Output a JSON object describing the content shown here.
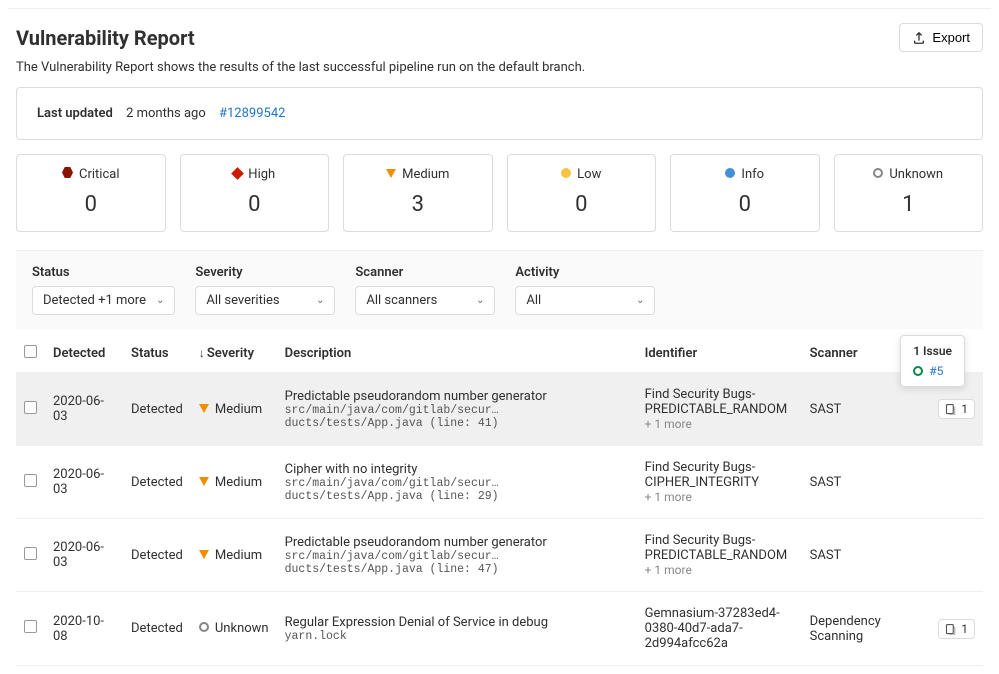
{
  "header": {
    "title": "Vulnerability Report",
    "export_label": "Export",
    "subtitle": "The Vulnerability Report shows the results of the last successful pipeline run on the default branch."
  },
  "last_updated": {
    "label": "Last updated",
    "ago": "2 months ago",
    "pipeline_link": "#12899542"
  },
  "severity_cards": [
    {
      "name": "Critical",
      "count": "0",
      "color": "#8b1300",
      "shape": "hexagon"
    },
    {
      "name": "High",
      "count": "0",
      "color": "#c91c00",
      "shape": "diamond"
    },
    {
      "name": "Medium",
      "count": "3",
      "color": "#ef8e00",
      "shape": "triangle-down"
    },
    {
      "name": "Low",
      "count": "0",
      "color": "#f6c342",
      "shape": "circle-fill"
    },
    {
      "name": "Info",
      "count": "0",
      "color": "#428fdc",
      "shape": "circle-fill"
    },
    {
      "name": "Unknown",
      "count": "1",
      "color": "#868686",
      "shape": "ring"
    }
  ],
  "filters": {
    "status": {
      "label": "Status",
      "value": "Detected +1 more"
    },
    "severity": {
      "label": "Severity",
      "value": "All severities"
    },
    "scanner": {
      "label": "Scanner",
      "value": "All scanners"
    },
    "activity": {
      "label": "Activity",
      "value": "All"
    }
  },
  "columns": {
    "detected": "Detected",
    "status": "Status",
    "severity": "Severity",
    "description": "Description",
    "identifier": "Identifier",
    "scanner": "Scanner"
  },
  "popover": {
    "title": "1 Issue",
    "link_text": "#5",
    "ring_color": "#108548"
  },
  "rows": [
    {
      "detected": "2020-06-03",
      "status": "Detected",
      "severity": "Medium",
      "sev_color": "#ef8e00",
      "sev_shape": "triangle-down",
      "desc_title": "Predictable pseudorandom number generator",
      "desc_path": "src/main/java/com/gitlab/secur…ducts/tests/App.java (line: 41)",
      "identifier": "Find Security Bugs-PREDICTABLE_RANDOM",
      "id_more": "+ 1 more",
      "scanner": "SAST",
      "issue_count": "1",
      "hovered": true
    },
    {
      "detected": "2020-06-03",
      "status": "Detected",
      "severity": "Medium",
      "sev_color": "#ef8e00",
      "sev_shape": "triangle-down",
      "desc_title": "Cipher with no integrity",
      "desc_path": "src/main/java/com/gitlab/secur…ducts/tests/App.java (line: 29)",
      "identifier": "Find Security Bugs-CIPHER_INTEGRITY",
      "id_more": "+ 1 more",
      "scanner": "SAST",
      "issue_count": "",
      "hovered": false
    },
    {
      "detected": "2020-06-03",
      "status": "Detected",
      "severity": "Medium",
      "sev_color": "#ef8e00",
      "sev_shape": "triangle-down",
      "desc_title": "Predictable pseudorandom number generator",
      "desc_path": "src/main/java/com/gitlab/secur…ducts/tests/App.java (line: 47)",
      "identifier": "Find Security Bugs-PREDICTABLE_RANDOM",
      "id_more": "+ 1 more",
      "scanner": "SAST",
      "issue_count": "",
      "hovered": false
    },
    {
      "detected": "2020-10-08",
      "status": "Detected",
      "severity": "Unknown",
      "sev_color": "#868686",
      "sev_shape": "ring",
      "desc_title": "Regular Expression Denial of Service in debug",
      "desc_path": "yarn.lock",
      "identifier": "Gemnasium-37283ed4-0380-40d7-ada7-2d994afcc62a",
      "id_more": "",
      "scanner": "Dependency Scanning",
      "issue_count": "1",
      "hovered": false
    }
  ]
}
